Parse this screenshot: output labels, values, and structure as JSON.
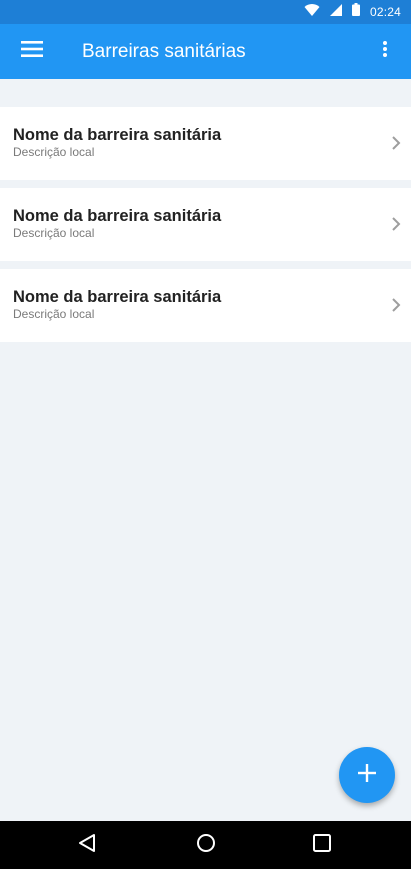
{
  "status_bar": {
    "time": "02:24",
    "icons": [
      "wifi-icon",
      "signal-icon",
      "battery-icon"
    ]
  },
  "app_bar": {
    "title": "Barreiras sanitárias",
    "menu_icon": "hamburger-menu-icon",
    "more_icon": "more-vertical-icon"
  },
  "list": {
    "items": [
      {
        "title": "Nome da barreira sanitária",
        "subtitle": "Descrição local"
      },
      {
        "title": "Nome da barreira sanitária",
        "subtitle": "Descrição local"
      },
      {
        "title": "Nome da barreira sanitária",
        "subtitle": "Descrição local"
      }
    ]
  },
  "fab": {
    "icon": "plus-icon"
  },
  "nav_bar": {
    "icons": [
      "back-icon",
      "home-icon",
      "recents-icon"
    ]
  },
  "colors": {
    "primary": "#2196f3",
    "status_bar": "#1e7fd6",
    "background": "#eff3f7"
  }
}
